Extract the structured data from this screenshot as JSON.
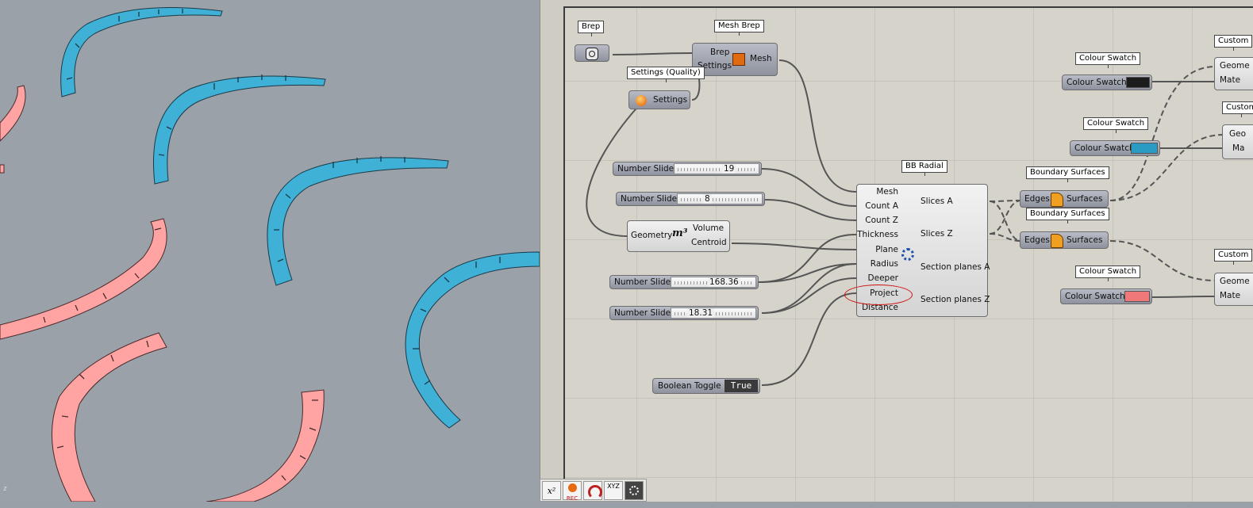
{
  "viewport": {
    "axis_label": "z"
  },
  "components": {
    "brep": {
      "tag": "Brep"
    },
    "mesh_brep": {
      "tag": "Mesh Brep",
      "in1": "Brep",
      "in2": "Settings",
      "out": "Mesh"
    },
    "settings": {
      "tag": "Settings (Quality)",
      "label": "Settings"
    },
    "slider1": {
      "label": "Number Slider",
      "value": "19"
    },
    "slider2": {
      "label": "Number Slider",
      "value": "8"
    },
    "volume": {
      "in": "Geometry",
      "symbol": "m³",
      "out1": "Volume",
      "out2": "Centroid"
    },
    "slider3": {
      "label": "Number Slider",
      "value": "168.36"
    },
    "slider4": {
      "label": "Number Slider",
      "value": "18.31"
    },
    "toggle": {
      "label": "Boolean Toggle",
      "value": "True"
    },
    "bb_radial": {
      "tag": "BB Radial",
      "inputs": [
        "Mesh",
        "Count A",
        "Count Z",
        "Thickness",
        "Plane",
        "Radius",
        "Deeper",
        "Project",
        "Distance"
      ],
      "outputs": [
        "Slices A",
        "Slices Z",
        "Section planes A",
        "Section planes Z"
      ]
    },
    "boundary1": {
      "tag": "Boundary Surfaces",
      "in": "Edges",
      "out": "Surfaces"
    },
    "boundary2": {
      "tag": "Boundary Surfaces",
      "in": "Edges",
      "out": "Surfaces"
    },
    "swatch1": {
      "tag": "Colour Swatch",
      "label": "Colour Swatch",
      "color": "#1c1c1c"
    },
    "swatch2": {
      "tag": "Colour Swatch",
      "label": "Colour Swatch",
      "color": "#2a9cc4"
    },
    "swatch3": {
      "tag": "Colour Swatch",
      "label": "Colour Swatch",
      "color": "#f07878"
    },
    "custom1": {
      "tag": "Custom",
      "in1": "Geome",
      "in2": "Mate"
    },
    "custom2": {
      "tag": "Custom",
      "in1": "Geo",
      "in2": "Ma"
    },
    "custom3": {
      "tag": "Custom",
      "in1": "Geome",
      "in2": "Mate"
    }
  },
  "toolbar": {
    "items": [
      "x²",
      "REC",
      "",
      "XYZ",
      ""
    ]
  },
  "colors": {
    "blue_arc": "#3fb0d6",
    "pink_arc": "#ffa3a3",
    "viewport_bg": "#9ba1a9",
    "canvas_bg": "#d6d3cb",
    "annotation": "#d01010"
  }
}
